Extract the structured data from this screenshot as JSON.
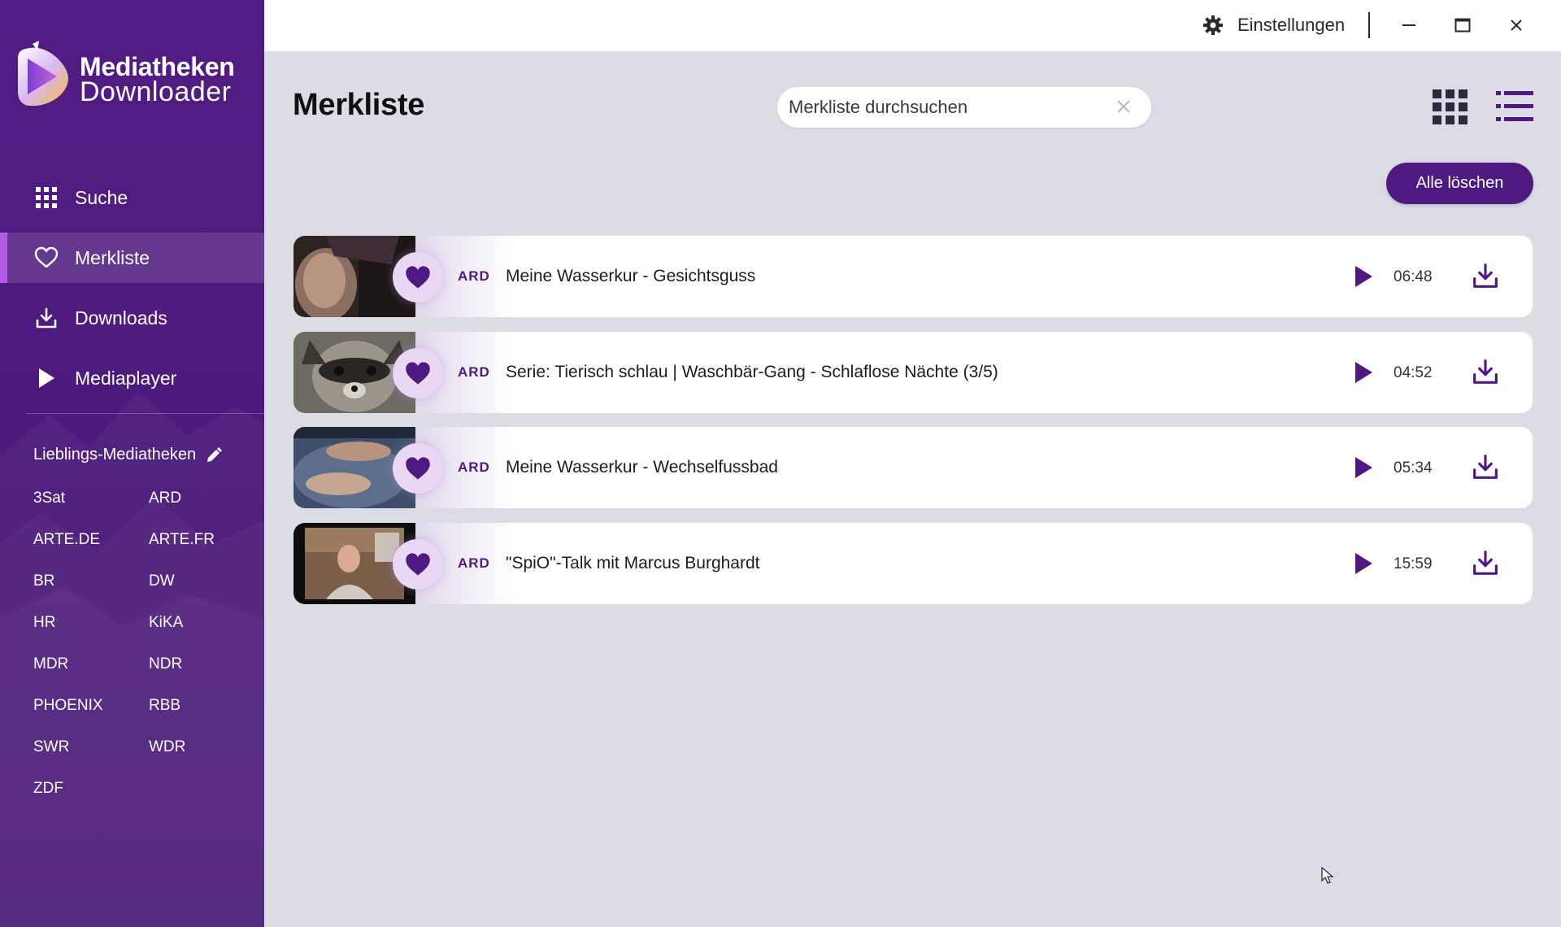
{
  "app": {
    "logo_line1": "Mediatheken",
    "logo_line2": "Downloader"
  },
  "titlebar": {
    "settings_label": "Einstellungen",
    "settings_icon": "gear-icon",
    "minimize_icon": "minimize-icon",
    "maximize_icon": "maximize-icon",
    "close_icon": "close-icon"
  },
  "sidebar": {
    "nav": [
      {
        "label": "Suche",
        "icon": "grid-icon",
        "active": false
      },
      {
        "label": "Merkliste",
        "icon": "heart-icon",
        "active": true
      },
      {
        "label": "Downloads",
        "icon": "download-icon",
        "active": false
      },
      {
        "label": "Mediaplayer",
        "icon": "play-icon",
        "active": false
      }
    ],
    "favorites_title": "Lieblings-Mediatheken",
    "favorites": [
      "3Sat",
      "ARD",
      "ARTE.DE",
      "ARTE.FR",
      "BR",
      "DW",
      "HR",
      "KiKA",
      "MDR",
      "NDR",
      "PHOENIX",
      "RBB",
      "SWR",
      "WDR",
      "ZDF"
    ]
  },
  "main": {
    "page_title": "Merkliste",
    "search_placeholder": "Merkliste durchsuchen",
    "clear_all_label": "Alle löschen",
    "items": [
      {
        "channel": "ARD",
        "title": "Meine Wasserkur - Gesichtsguss",
        "duration": "06:48"
      },
      {
        "channel": "ARD",
        "title": "Serie: Tierisch schlau | Waschbär-Gang - Schlaflose Nächte (3/5)",
        "duration": "04:52"
      },
      {
        "channel": "ARD",
        "title": "Meine Wasserkur - Wechselfussbad",
        "duration": "05:34"
      },
      {
        "channel": "ARD",
        "title": "\"SpiO\"-Talk mit Marcus Burghardt",
        "duration": "15:59"
      }
    ]
  },
  "colors": {
    "sidebar_bg": "#4c1a7c",
    "accent": "#4e1a82",
    "active_marker": "#b35ae6",
    "content_bg": "#dcdce5"
  }
}
